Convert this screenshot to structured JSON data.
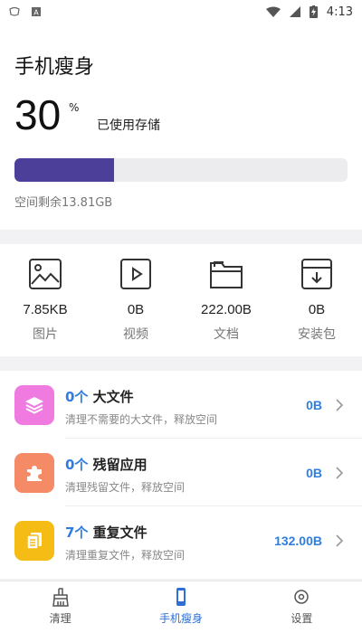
{
  "statusbar": {
    "time": "4:13"
  },
  "header": {
    "title": "手机瘦身"
  },
  "storage": {
    "percent": "30",
    "percent_sign": "%",
    "used_label": "已使用存储",
    "used_fraction": 0.3,
    "remaining": "空间剩余13.81GB"
  },
  "categories": [
    {
      "size": "7.85KB",
      "label": "图片",
      "icon": "image-icon"
    },
    {
      "size": "0B",
      "label": "视频",
      "icon": "video-icon"
    },
    {
      "size": "222.00B",
      "label": "文档",
      "icon": "folder-icon"
    },
    {
      "size": "0B",
      "label": "安装包",
      "icon": "download-icon"
    }
  ],
  "cleanup_items": [
    {
      "count": "0个",
      "title": "大文件",
      "desc": "清理不需要的大文件，释放空间",
      "size": "0B",
      "color": "#f07be0",
      "icon": "layers-icon"
    },
    {
      "count": "0个",
      "title": "残留应用",
      "desc": "清理残留文件，释放空间",
      "size": "0B",
      "color": "#f48a66",
      "icon": "puzzle-icon"
    },
    {
      "count": "7个",
      "title": "重复文件",
      "desc": "清理重复文件，释放空间",
      "size": "132.00B",
      "color": "#f5bc15",
      "icon": "copy-icon"
    }
  ],
  "tabs": [
    {
      "label": "清理",
      "icon": "broom-icon",
      "active": false
    },
    {
      "label": "手机瘦身",
      "icon": "phone-icon",
      "active": true
    },
    {
      "label": "设置",
      "icon": "settings-icon",
      "active": false
    }
  ]
}
